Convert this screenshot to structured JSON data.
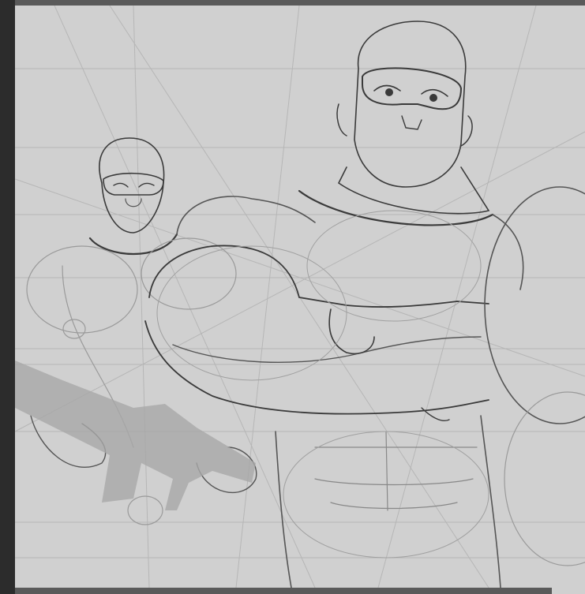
{
  "canvas": {
    "background_color": "#d0d0d0",
    "frame_color": "#2c2c2c",
    "stroke_dark": "#3a3a3a",
    "stroke_light": "#9a9a9a",
    "guide_color": "#b4b4b4"
  },
  "figures": [
    {
      "name": "foreground-masked-figure-arms-crossed"
    },
    {
      "name": "background-masked-figure-with-rifle"
    }
  ]
}
